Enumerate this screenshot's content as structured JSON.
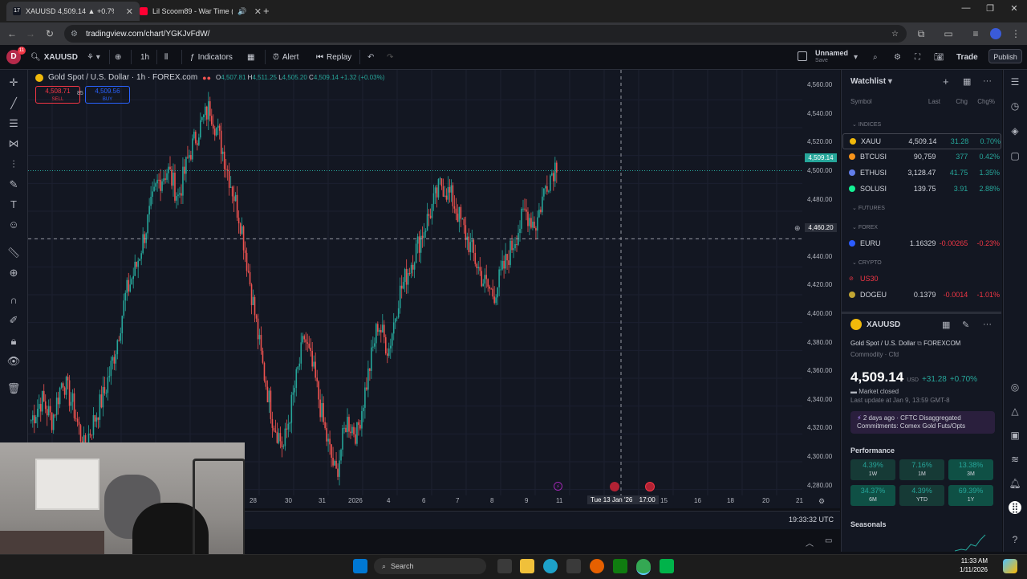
{
  "browser": {
    "tabs": [
      {
        "title": "XAUUSD 4,509.14 ▲ +0.7% Un"
      },
      {
        "title": "Lil Scoom89 - War Time (O"
      }
    ],
    "url": "tradingview.com/chart/YGKJvFdW/"
  },
  "header": {
    "avatar_letter": "D",
    "avatar_badge": "11",
    "symbol": "XAUUSD",
    "interval": "1h",
    "indicators_label": "Indicators",
    "alert_label": "Alert",
    "replay_label": "Replay",
    "layout_name": "Unnamed",
    "layout_sub": "Save",
    "trade_label": "Trade",
    "publish_label": "Publish"
  },
  "legend": {
    "title": "Gold Spot / U.S. Dollar · 1h · FOREX.com",
    "o_label": "O",
    "o": "4,507.81",
    "h_label": "H",
    "h": "4,511.25",
    "l_label": "L",
    "l": "4,505.20",
    "c_label": "C",
    "c": "4,509.14",
    "change": "+1.32 (+0.03%)",
    "sell_price": "4,508.71",
    "sell_label": "SELL",
    "spread": "85",
    "buy_price": "4,509.56",
    "buy_label": "BUY"
  },
  "price_scale": [
    "4,560.00",
    "4,540.00",
    "4,520.00",
    "4,500.00",
    "4,480.00",
    "4,460.00",
    "4,440.00",
    "4,420.00",
    "4,400.00",
    "4,380.00",
    "4,360.00",
    "4,340.00",
    "4,320.00",
    "4,300.00",
    "4,280.00"
  ],
  "last_price_tag": "4,509.14",
  "crosshair_price": "4,460.20",
  "time_scale": [
    "28",
    "30",
    "31",
    "2026",
    "4",
    "6",
    "7",
    "8",
    "9",
    "11",
    "15",
    "16",
    "18",
    "20",
    "21"
  ],
  "crosshair_time": "Tue 13 Jan '26",
  "crosshair_time2": "17:00",
  "clock": "19:33:32 UTC",
  "chart_colors": {
    "up": "#26a69a",
    "down": "#ef5350",
    "bg": "#131722"
  },
  "chart_data": {
    "type": "candlestick",
    "symbol": "XAUUSD",
    "interval": "1h",
    "ylim": [
      4270,
      4570
    ],
    "closes_approx": [
      4330,
      4345,
      4330,
      4360,
      4340,
      4310,
      4330,
      4350,
      4380,
      4420,
      4440,
      4470,
      4500,
      4510,
      4490,
      4520,
      4540,
      4555,
      4530,
      4500,
      4470,
      4420,
      4370,
      4330,
      4310,
      4350,
      4390,
      4360,
      4320,
      4290,
      4330,
      4320,
      4360,
      4400,
      4380,
      4420,
      4440,
      4460,
      4480,
      4500,
      4490,
      4470,
      4450,
      4430,
      4420,
      4440,
      4460,
      4480,
      4470,
      4500,
      4515
    ]
  },
  "watchlist": {
    "title": "Watchlist",
    "cols": {
      "symbol": "Symbol",
      "last": "Last",
      "chg": "Chg",
      "chgp": "Chg%"
    },
    "sections": {
      "indices": "INDICES",
      "futures": "FUTURES",
      "forex": "FOREX",
      "crypto": "CRYPTO"
    },
    "rows": [
      {
        "sym": "XAUU",
        "last": "4,509.14",
        "chg": "31.28",
        "chgp": "0.70%"
      },
      {
        "sym": "BTCUSI",
        "last": "90,759",
        "chg": "377",
        "chgp": "0.42%"
      },
      {
        "sym": "ETHUSI",
        "last": "3,128.47",
        "chg": "41.75",
        "chgp": "1.35%"
      },
      {
        "sym": "SOLUSI",
        "last": "139.75",
        "chg": "3.91",
        "chgp": "2.88%"
      },
      {
        "sym": "EURU",
        "last": "1.16329",
        "chg": "-0.00265",
        "chgp": "-0.23%"
      },
      {
        "sym": "US30",
        "last": "",
        "chg": "",
        "chgp": ""
      },
      {
        "sym": "DOGEU",
        "last": "0.1379",
        "chg": "-0.0014",
        "chgp": "-1.01%"
      }
    ]
  },
  "details": {
    "symbol": "XAUUSD",
    "name": "Gold Spot / U.S. Dollar",
    "exchange": "FOREXCOM",
    "type": "Commodity · Cfd",
    "price": "4,509.14",
    "currency": "USD",
    "change": "+31.28",
    "change_pct": "+0.70%",
    "status": "Market closed",
    "last_update": "Last update at Jan 9, 13:59 GMT-8",
    "news_time": "2 days ago",
    "news_text": "· CFTC Disaggregated Commitments: Comex Gold Futs/Opts",
    "performance_label": "Performance",
    "performance": [
      {
        "pct": "4.39%",
        "label": "1W"
      },
      {
        "pct": "7.16%",
        "label": "1M"
      },
      {
        "pct": "13.38%",
        "label": "3M"
      },
      {
        "pct": "34.37%",
        "label": "6M"
      },
      {
        "pct": "4.39%",
        "label": "YTD"
      },
      {
        "pct": "69.39%",
        "label": "1Y"
      }
    ],
    "seasonals_label": "Seasonals"
  },
  "taskbar": {
    "search_label": "Search",
    "time": "11:33 AM",
    "date": "1/11/2026"
  }
}
